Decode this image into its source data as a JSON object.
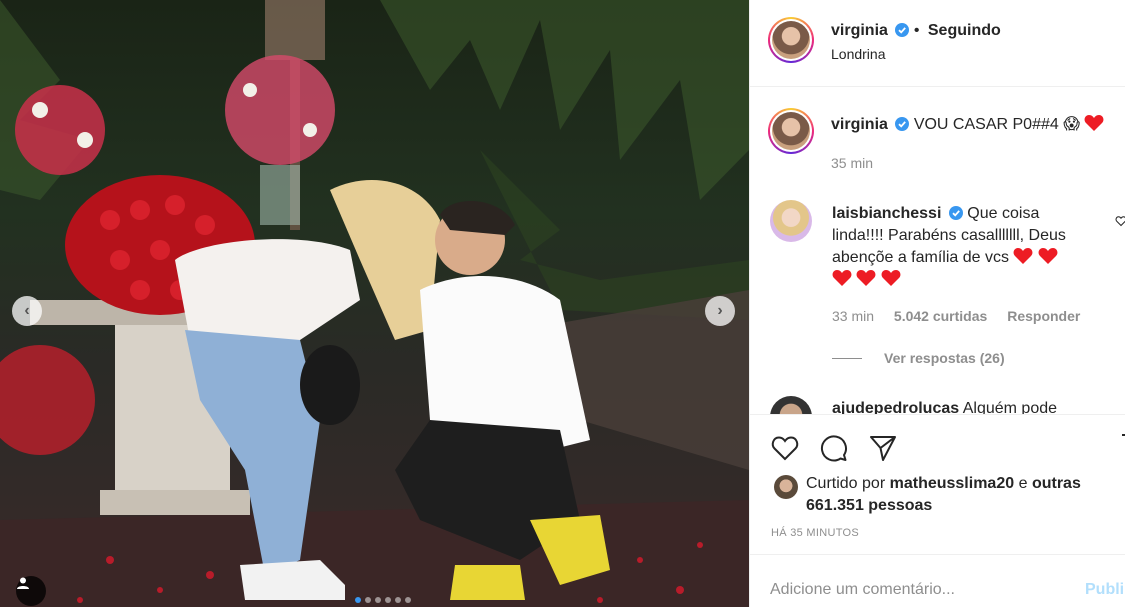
{
  "post": {
    "photo_alt": "",
    "carousel": {
      "count": 6,
      "active_index": 0
    }
  },
  "header": {
    "username": "virginia",
    "separator": "•",
    "follow_status": "Seguindo",
    "location": "Londrina"
  },
  "caption": {
    "username": "virginia",
    "text": "VOU CASAR P0##4",
    "emoji": "😱",
    "time": "35 min"
  },
  "comments": [
    {
      "username": "laisbianchessi",
      "text": "Que coisa linda!!!! Parabéns casalllllll, Deus abençõe a família de vcs",
      "time": "33 min",
      "likes": "5.042 curtidas",
      "reply_label": "Responder",
      "replies_label": "Ver respostas (26)"
    },
    {
      "username": "ajudepedrolucas",
      "text": "Alguém pode"
    }
  ],
  "likes": {
    "prefix": "Curtido por",
    "user": "matheusslima20",
    "conj": "e",
    "others": "outras 661.351 pessoas"
  },
  "timeago": "HÁ 35 MINUTOS",
  "add_comment": {
    "placeholder": "Adicione um comentário...",
    "post_label": "Publi"
  },
  "colors": {
    "verified": "#3897f0",
    "heart": "#ed4956",
    "post_button": "#b2dffc",
    "muted": "#8e8e8e"
  }
}
